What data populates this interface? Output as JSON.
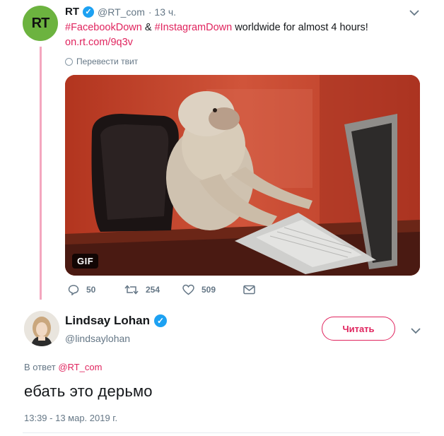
{
  "tweet1": {
    "author_name": "RT",
    "avatar_text": "RT",
    "handle": "@RT_com",
    "time": "· 13 ч.",
    "hashtag1": "#FacebookDown",
    "amp": "&",
    "hashtag2": "#InstagramDown",
    "text_rest": "worldwide for almost 4 hours!",
    "link": "on.rt.com/9q3v",
    "translate_label": "Перевести твит",
    "media_badge": "GIF",
    "replies": "50",
    "retweets": "254",
    "likes": "509"
  },
  "tweet2": {
    "author_name": "Lindsay Lohan",
    "handle": "@lindsaylohan",
    "follow_label": "Читать",
    "reply_prefix": "В ответ",
    "reply_handle": "@RT_com",
    "text": "ебать это дерьмо",
    "timestamp": "13:39 - 13 мар. 2019 г."
  },
  "colors": {
    "accent": "#e0245e",
    "verified": "#1da1f2",
    "thread_line": "#f4a7bf",
    "rt_green": "#6cb33f",
    "muted": "#657786"
  },
  "icons": {
    "reply": "reply-icon",
    "retweet": "retweet-icon",
    "like": "heart-icon",
    "message": "envelope-icon",
    "more": "chevron-down-icon",
    "verified": "verified-badge-icon",
    "translate": "globe-icon"
  }
}
